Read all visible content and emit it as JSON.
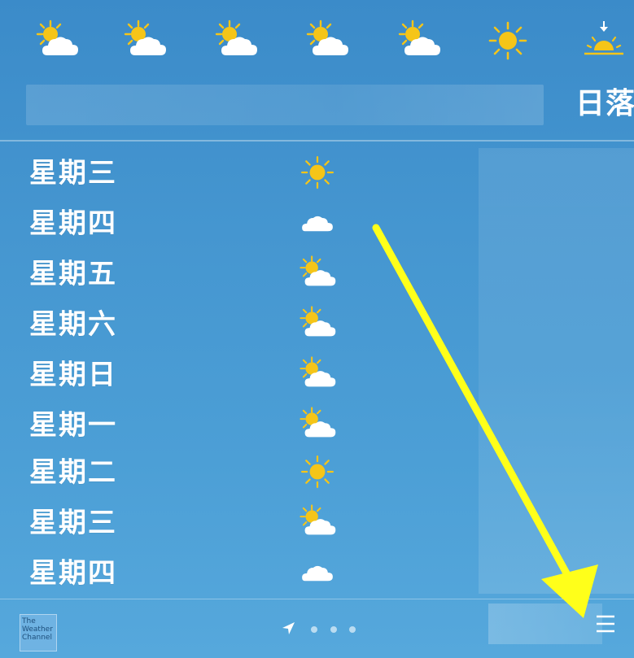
{
  "hourly": {
    "icons": [
      "partly-cloudy-icon",
      "partly-cloudy-icon",
      "partly-cloudy-icon",
      "partly-cloudy-icon",
      "partly-cloudy-icon",
      "sun-icon",
      "sunset-icon"
    ]
  },
  "summary": {
    "sunset_label": "日落"
  },
  "forecast": {
    "days": [
      {
        "label": "星期三",
        "icon": "sun-icon"
      },
      {
        "label": "星期四",
        "icon": "cloud-icon"
      },
      {
        "label": "星期五",
        "icon": "partly-cloudy-icon"
      },
      {
        "label": "星期六",
        "icon": "partly-cloudy-icon"
      },
      {
        "label": "星期日",
        "icon": "partly-cloudy-icon"
      },
      {
        "label": "星期一",
        "icon": "partly-cloudy-icon"
      },
      {
        "label": "星期二",
        "icon": "sun-icon"
      },
      {
        "label": "星期三",
        "icon": "partly-cloudy-icon"
      },
      {
        "label": "星期四",
        "icon": "cloud-icon"
      }
    ]
  },
  "footer": {
    "logo_line1": "The",
    "logo_line2": "Weather",
    "logo_line3": "Channel",
    "page_count": 3
  },
  "colors": {
    "background_top": "#3b8bc9",
    "background_bottom": "#56a8dc",
    "sun": "#f5c518",
    "annotation_arrow": "#ffff1a"
  }
}
